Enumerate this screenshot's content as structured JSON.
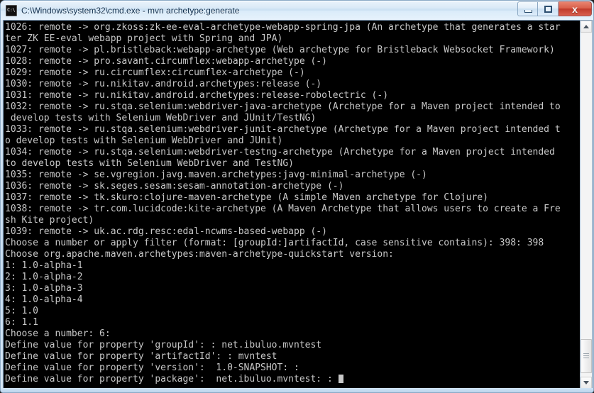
{
  "window": {
    "title": "C:\\Windows\\system32\\cmd.exe - mvn  archetype:generate",
    "icon": "cmd-console-icon",
    "buttons": {
      "minimize_label": "–",
      "maximize_label": "□",
      "close_label": "x"
    }
  },
  "console": {
    "background_color": "#000000",
    "text_color": "#c8c8c8",
    "lines": [
      "1026: remote -> org.zkoss:zk-ee-eval-archetype-webapp-spring-jpa (An archetype that generates a star",
      "ter ZK EE-eval webapp project with Spring and JPA)",
      "1027: remote -> pl.bristleback:webapp-archetype (Web archetype for Bristleback Websocket Framework)",
      "1028: remote -> pro.savant.circumflex:webapp-archetype (-)",
      "1029: remote -> ru.circumflex:circumflex-archetype (-)",
      "1030: remote -> ru.nikitav.android.archetypes:release (-)",
      "1031: remote -> ru.nikitav.android.archetypes:release-robolectric (-)",
      "1032: remote -> ru.stqa.selenium:webdriver-java-archetype (Archetype for a Maven project intended to",
      " develop tests with Selenium WebDriver and JUnit/TestNG)",
      "1033: remote -> ru.stqa.selenium:webdriver-junit-archetype (Archetype for a Maven project intended t",
      "o develop tests with Selenium WebDriver and JUnit)",
      "1034: remote -> ru.stqa.selenium:webdriver-testng-archetype (Archetype for a Maven project intended",
      "to develop tests with Selenium WebDriver and TestNG)",
      "1035: remote -> se.vgregion.javg.maven.archetypes:javg-minimal-archetype (-)",
      "1036: remote -> sk.seges.sesam:sesam-annotation-archetype (-)",
      "1037: remote -> tk.skuro:clojure-maven-archetype (A simple Maven archetype for Clojure)",
      "1038: remote -> tr.com.lucidcode:kite-archetype (A Maven Archetype that allows users to create a Fre",
      "sh Kite project)",
      "1039: remote -> uk.ac.rdg.resc:edal-ncwms-based-webapp (-)",
      "Choose a number or apply filter (format: [groupId:]artifactId, case sensitive contains): 398: 398",
      "Choose org.apache.maven.archetypes:maven-archetype-quickstart version:",
      "1: 1.0-alpha-1",
      "2: 1.0-alpha-2",
      "3: 1.0-alpha-3",
      "4: 1.0-alpha-4",
      "5: 1.0",
      "6: 1.1",
      "Choose a number: 6:",
      "Define value for property 'groupId': : net.ibuluo.mvntest",
      "Define value for property 'artifactId': : mvntest",
      "Define value for property 'version':  1.0-SNAPSHOT: :",
      "Define value for property 'package':  net.ibuluo.mvntest: : "
    ],
    "prompt_cursor": "block-cursor"
  },
  "scrollbar": {
    "up_arrow": "scroll-up-arrow",
    "down_arrow": "scroll-down-arrow",
    "thumb_top_percent": 89,
    "thumb_height_percent": 10
  }
}
